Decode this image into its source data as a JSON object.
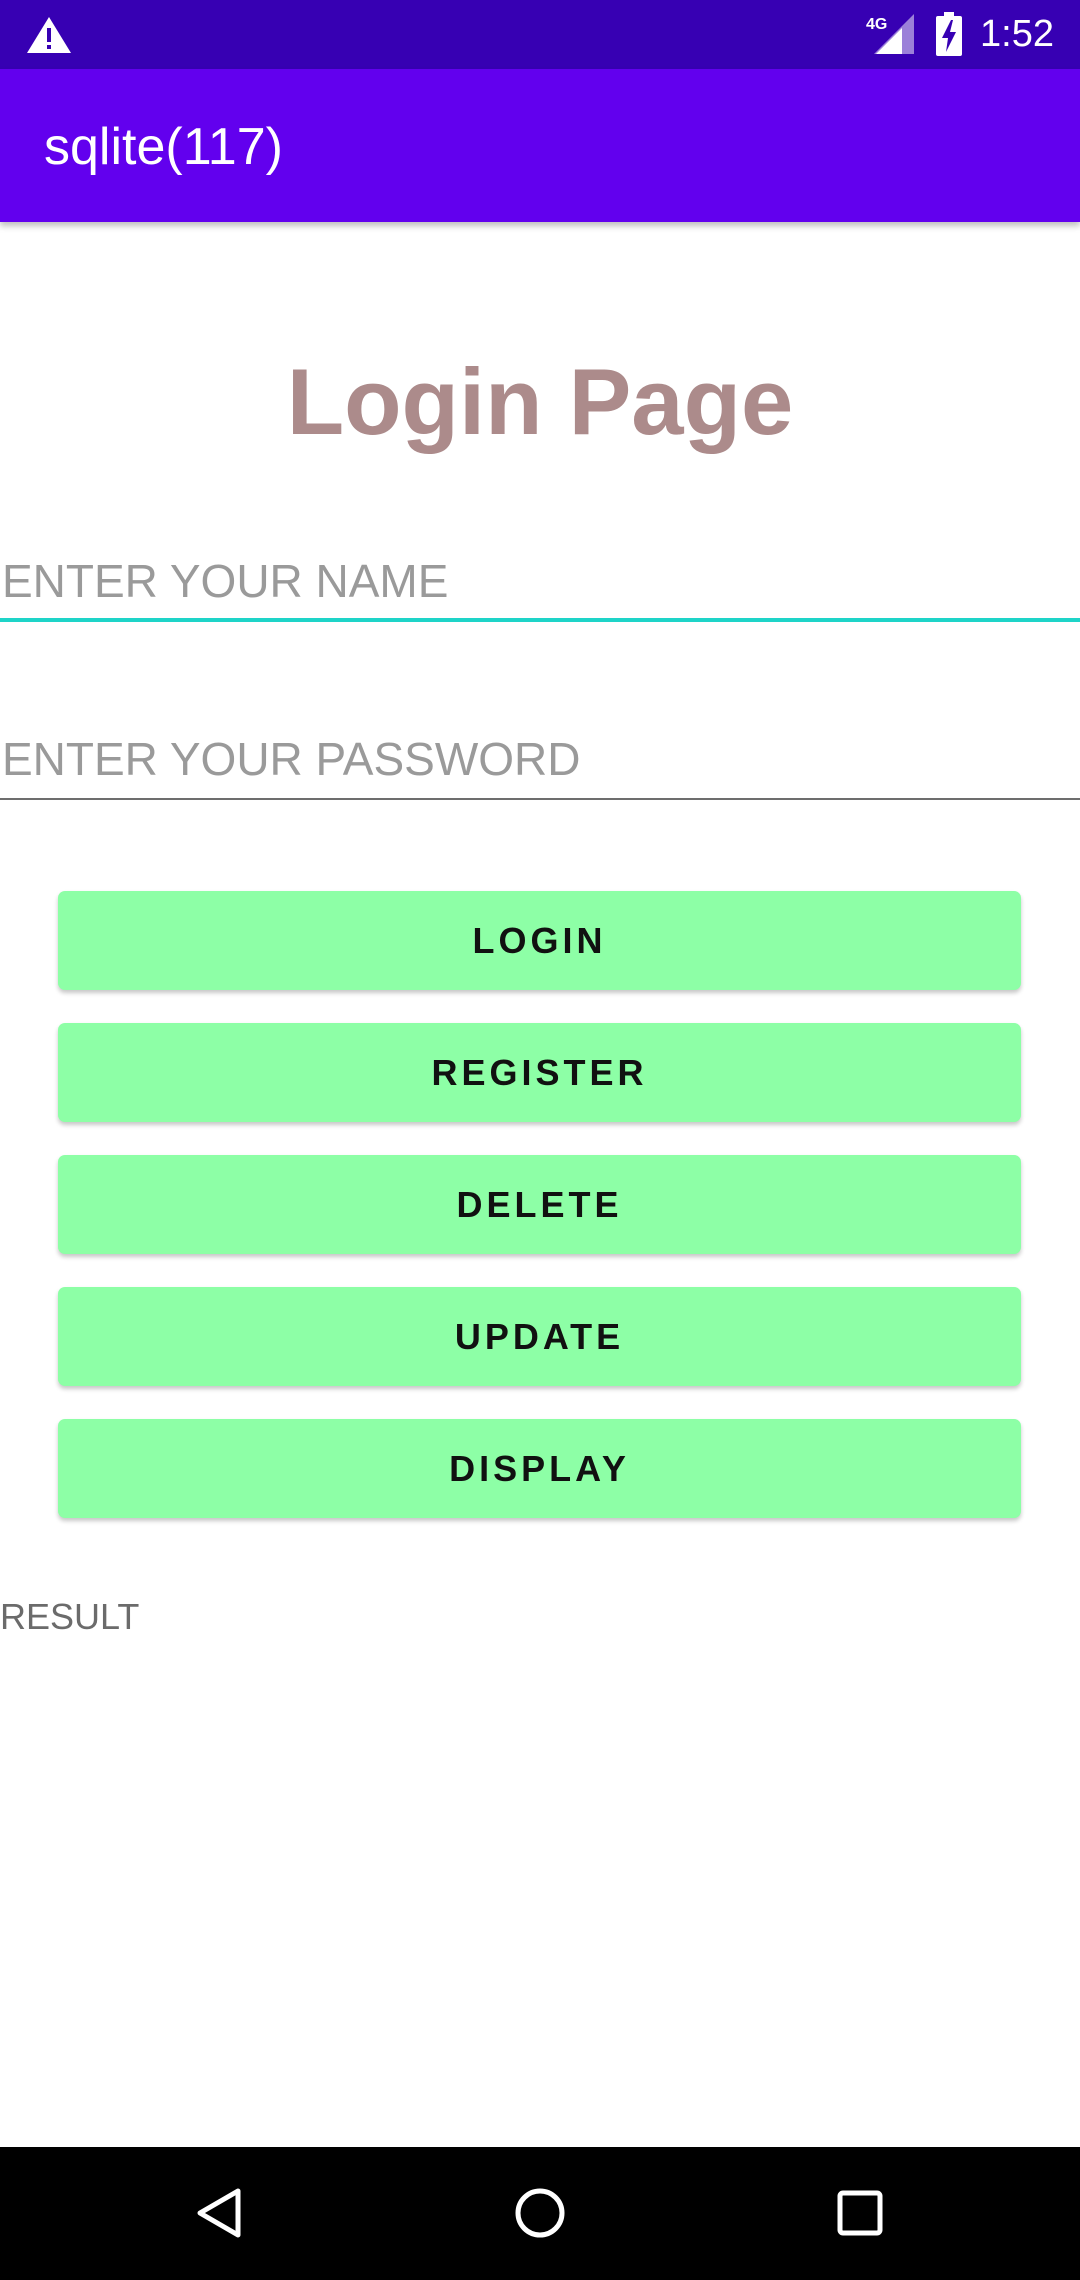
{
  "status_bar": {
    "time": "1:52",
    "network_label": "4G",
    "icons": [
      "warning-icon",
      "signal-icon",
      "battery-charging-icon"
    ]
  },
  "app_bar": {
    "title": "sqlite(117)"
  },
  "main": {
    "heading": "Login Page",
    "name_field": {
      "placeholder": "ENTER YOUR NAME",
      "value": ""
    },
    "password_field": {
      "placeholder": "ENTER YOUR PASSWORD",
      "value": ""
    },
    "buttons": {
      "login": "LOGIN",
      "register": "REGISTER",
      "delete": "DELETE",
      "update": "UPDATE",
      "display": "DISPLAY"
    },
    "result": "RESULT"
  },
  "nav_bar": {
    "icons": [
      "back-icon",
      "home-icon",
      "recents-icon"
    ]
  },
  "colors": {
    "status_bar": "#3700b3",
    "app_bar": "#6200ee",
    "heading": "#ac8b8b",
    "button": "#8dffa6",
    "focused_underline": "#1ed4c8"
  }
}
